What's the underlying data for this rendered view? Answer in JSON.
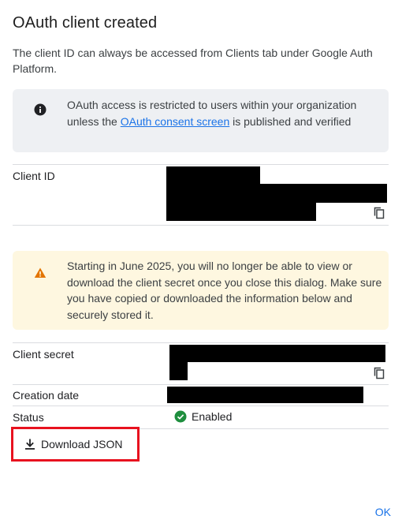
{
  "dialog": {
    "title": "OAuth client created",
    "subtitle": "The client ID can always be accessed from Clients tab under Google Auth Platform."
  },
  "info_banner": {
    "icon": "info-icon",
    "text_before": "OAuth access is restricted to users within your organization unless the ",
    "link_text": "OAuth consent screen",
    "text_after": " is published and verified"
  },
  "client_id": {
    "label": "Client ID",
    "copy_icon": "copy-icon"
  },
  "warning_banner": {
    "icon": "warning-icon",
    "text": "Starting in June 2025, you will no longer be able to view or download the client secret once you close this dialog. Make sure you have copied or downloaded the information below and securely stored it."
  },
  "client_secret": {
    "label": "Client secret",
    "copy_icon": "copy-icon"
  },
  "creation_date": {
    "label": "Creation date"
  },
  "status": {
    "label": "Status",
    "value": "Enabled",
    "icon": "check-circle-icon",
    "color": "#1e8e3e"
  },
  "actions": {
    "download_label": "Download JSON",
    "ok_label": "OK"
  },
  "colors": {
    "link": "#1a73e8",
    "highlight": "#e8121f",
    "info_bg": "#eef0f3",
    "warning_bg": "#fef7e0",
    "warning_icon": "#e37400"
  }
}
